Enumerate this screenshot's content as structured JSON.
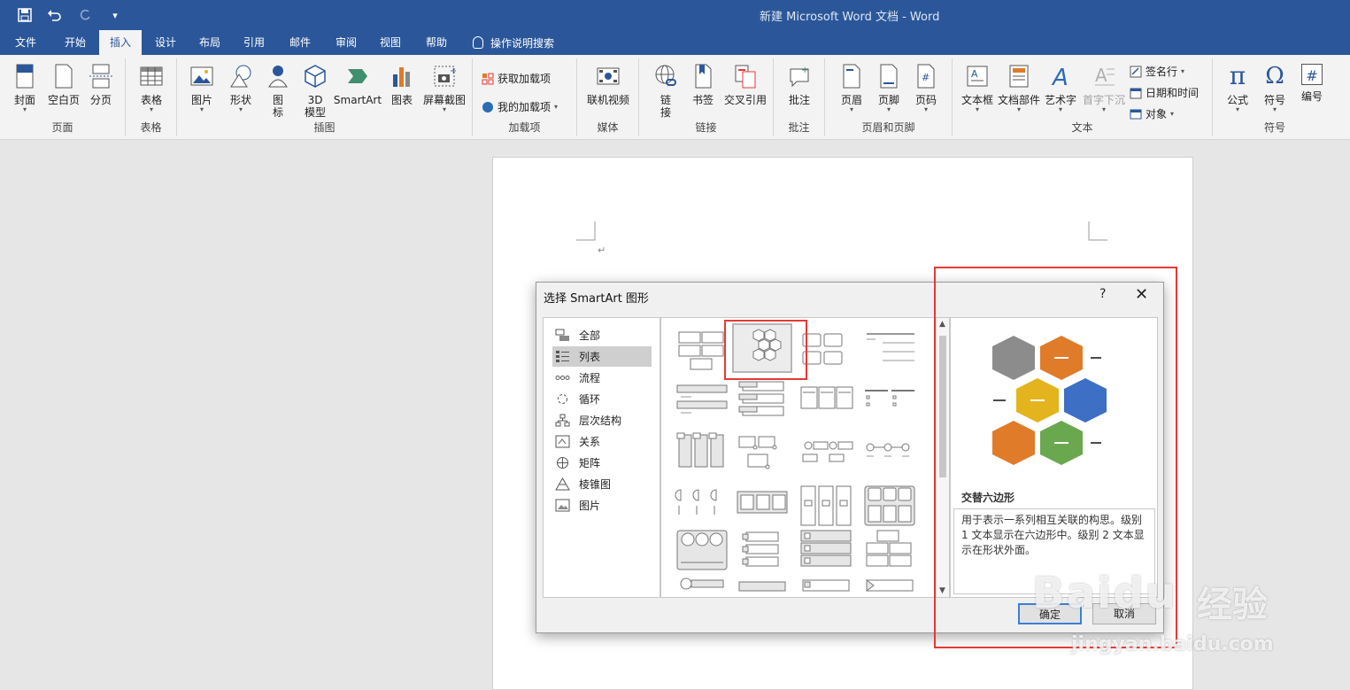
{
  "window": {
    "title": "新建 Microsoft Word 文档 - Word"
  },
  "tabs": [
    {
      "label": "文件"
    },
    {
      "label": "开始"
    },
    {
      "label": "插入"
    },
    {
      "label": "设计"
    },
    {
      "label": "布局"
    },
    {
      "label": "引用"
    },
    {
      "label": "邮件"
    },
    {
      "label": "审阅"
    },
    {
      "label": "视图"
    },
    {
      "label": "帮助"
    }
  ],
  "tell_me": "操作说明搜索",
  "ribbon": {
    "groups": {
      "pages": "页面",
      "tables": "表格",
      "illustrations": "插图",
      "addins": "加载项",
      "media": "媒体",
      "links": "链接",
      "comments": "批注",
      "header_footer": "页眉和页脚",
      "text": "文本",
      "symbols": "符号"
    },
    "buttons": {
      "cover": "封面",
      "blank": "空白页",
      "break": "分页",
      "table": "表格",
      "picture": "图片",
      "shapes": "形状",
      "icons_1": "图",
      "icons_2": "标",
      "model_1": "3D",
      "model_2": "模型",
      "smartart": "SmartArt",
      "chart": "图表",
      "screenshot": "屏幕截图",
      "get_addins": "获取加载项",
      "my_addins": "我的加载项",
      "online_video": "联机视频",
      "link_1": "链",
      "link_2": "接",
      "bookmark": "书签",
      "crossref": "交叉引用",
      "comment": "批注",
      "header": "页眉",
      "footer": "页脚",
      "page_number": "页码",
      "textbox": "文本框",
      "quickparts": "文档部件",
      "wordart": "艺术字",
      "dropcap": "首字下沉",
      "signature": "签名行",
      "datetime": "日期和时间",
      "object": "对象",
      "equation": "公式",
      "symbol": "符号",
      "number": "编号"
    },
    "icons": {
      "equation": "π",
      "symbol": "Ω",
      "number": "#"
    }
  },
  "dialog": {
    "title": "选择 SmartArt 图形",
    "help": "?",
    "close": "✕",
    "categories": [
      {
        "label": "全部"
      },
      {
        "label": "列表"
      },
      {
        "label": "流程"
      },
      {
        "label": "循环"
      },
      {
        "label": "层次结构"
      },
      {
        "label": "关系"
      },
      {
        "label": "矩阵"
      },
      {
        "label": "棱锥图"
      },
      {
        "label": "图片"
      }
    ],
    "selected_category": "列表",
    "preview": {
      "title": "交替六边形",
      "description": "用于表示一系列相互关联的构思。级别 1 文本显示在六边形中。级别 2 文本显示在形状外面。"
    },
    "ok_label": "确定",
    "cancel_label": "取消"
  },
  "watermark": {
    "brand": "Baidu",
    "brand_cn": "经验",
    "url": "jingyan.baidu.com"
  },
  "colors": {
    "accent": "#2b579a",
    "highlight": "#e53935",
    "hex_gray": "#8c8c8c",
    "hex_orange": "#e07b2a",
    "hex_yellow": "#e3b41e",
    "hex_blue": "#3d6fc4",
    "hex_green": "#6aa84f"
  }
}
